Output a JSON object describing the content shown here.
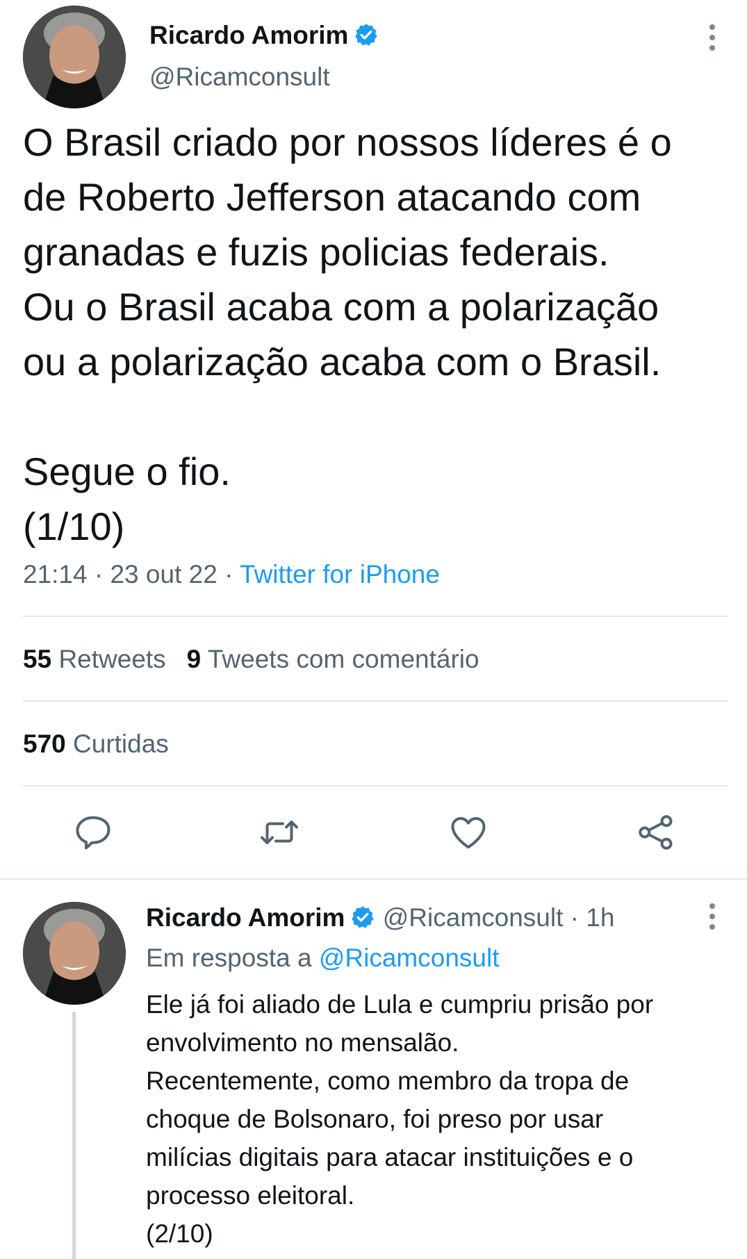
{
  "main_tweet": {
    "author_name": "Ricardo Amorim",
    "author_handle": "@Ricamconsult",
    "text": "O Brasil criado por nossos líderes é o\nde Roberto Jefferson atacando com\ngranadas e fuzis policias federais.\nOu o Brasil acaba com a polarização\nou a polarização acaba com o Brasil.\n\nSegue o fio.\n(1/10)",
    "time": "21:14",
    "date": "23 out 22",
    "separator": "·",
    "source": "Twitter for iPhone",
    "retweets_count": "55",
    "retweets_label": "Retweets",
    "quotes_count": "9",
    "quotes_label": "Tweets com comentário",
    "likes_count": "570",
    "likes_label": "Curtidas"
  },
  "actions": {
    "reply_icon": "reply-icon",
    "retweet_icon": "retweet-icon",
    "like_icon": "heart-icon",
    "share_icon": "share-icon"
  },
  "reply_tweet": {
    "author_name": "Ricardo Amorim",
    "author_handle": "@Ricamconsult",
    "separator": "·",
    "age": "1h",
    "reply_prefix": "Em resposta a",
    "reply_mention": "@Ricamconsult",
    "text": "Ele já foi aliado de Lula e cumpriu prisão por\nenvolvimento no mensalão.\nRecentemente, como membro da tropa de\nchoque de Bolsonaro, foi preso por usar\nmilícias digitais para atacar instituições e o\nprocesso eleitoral.\n(2/10)"
  },
  "colors": {
    "accent": "#1d9bf0",
    "text_primary": "#0f1419",
    "text_secondary": "#536471",
    "divider": "#e3e7ea"
  }
}
